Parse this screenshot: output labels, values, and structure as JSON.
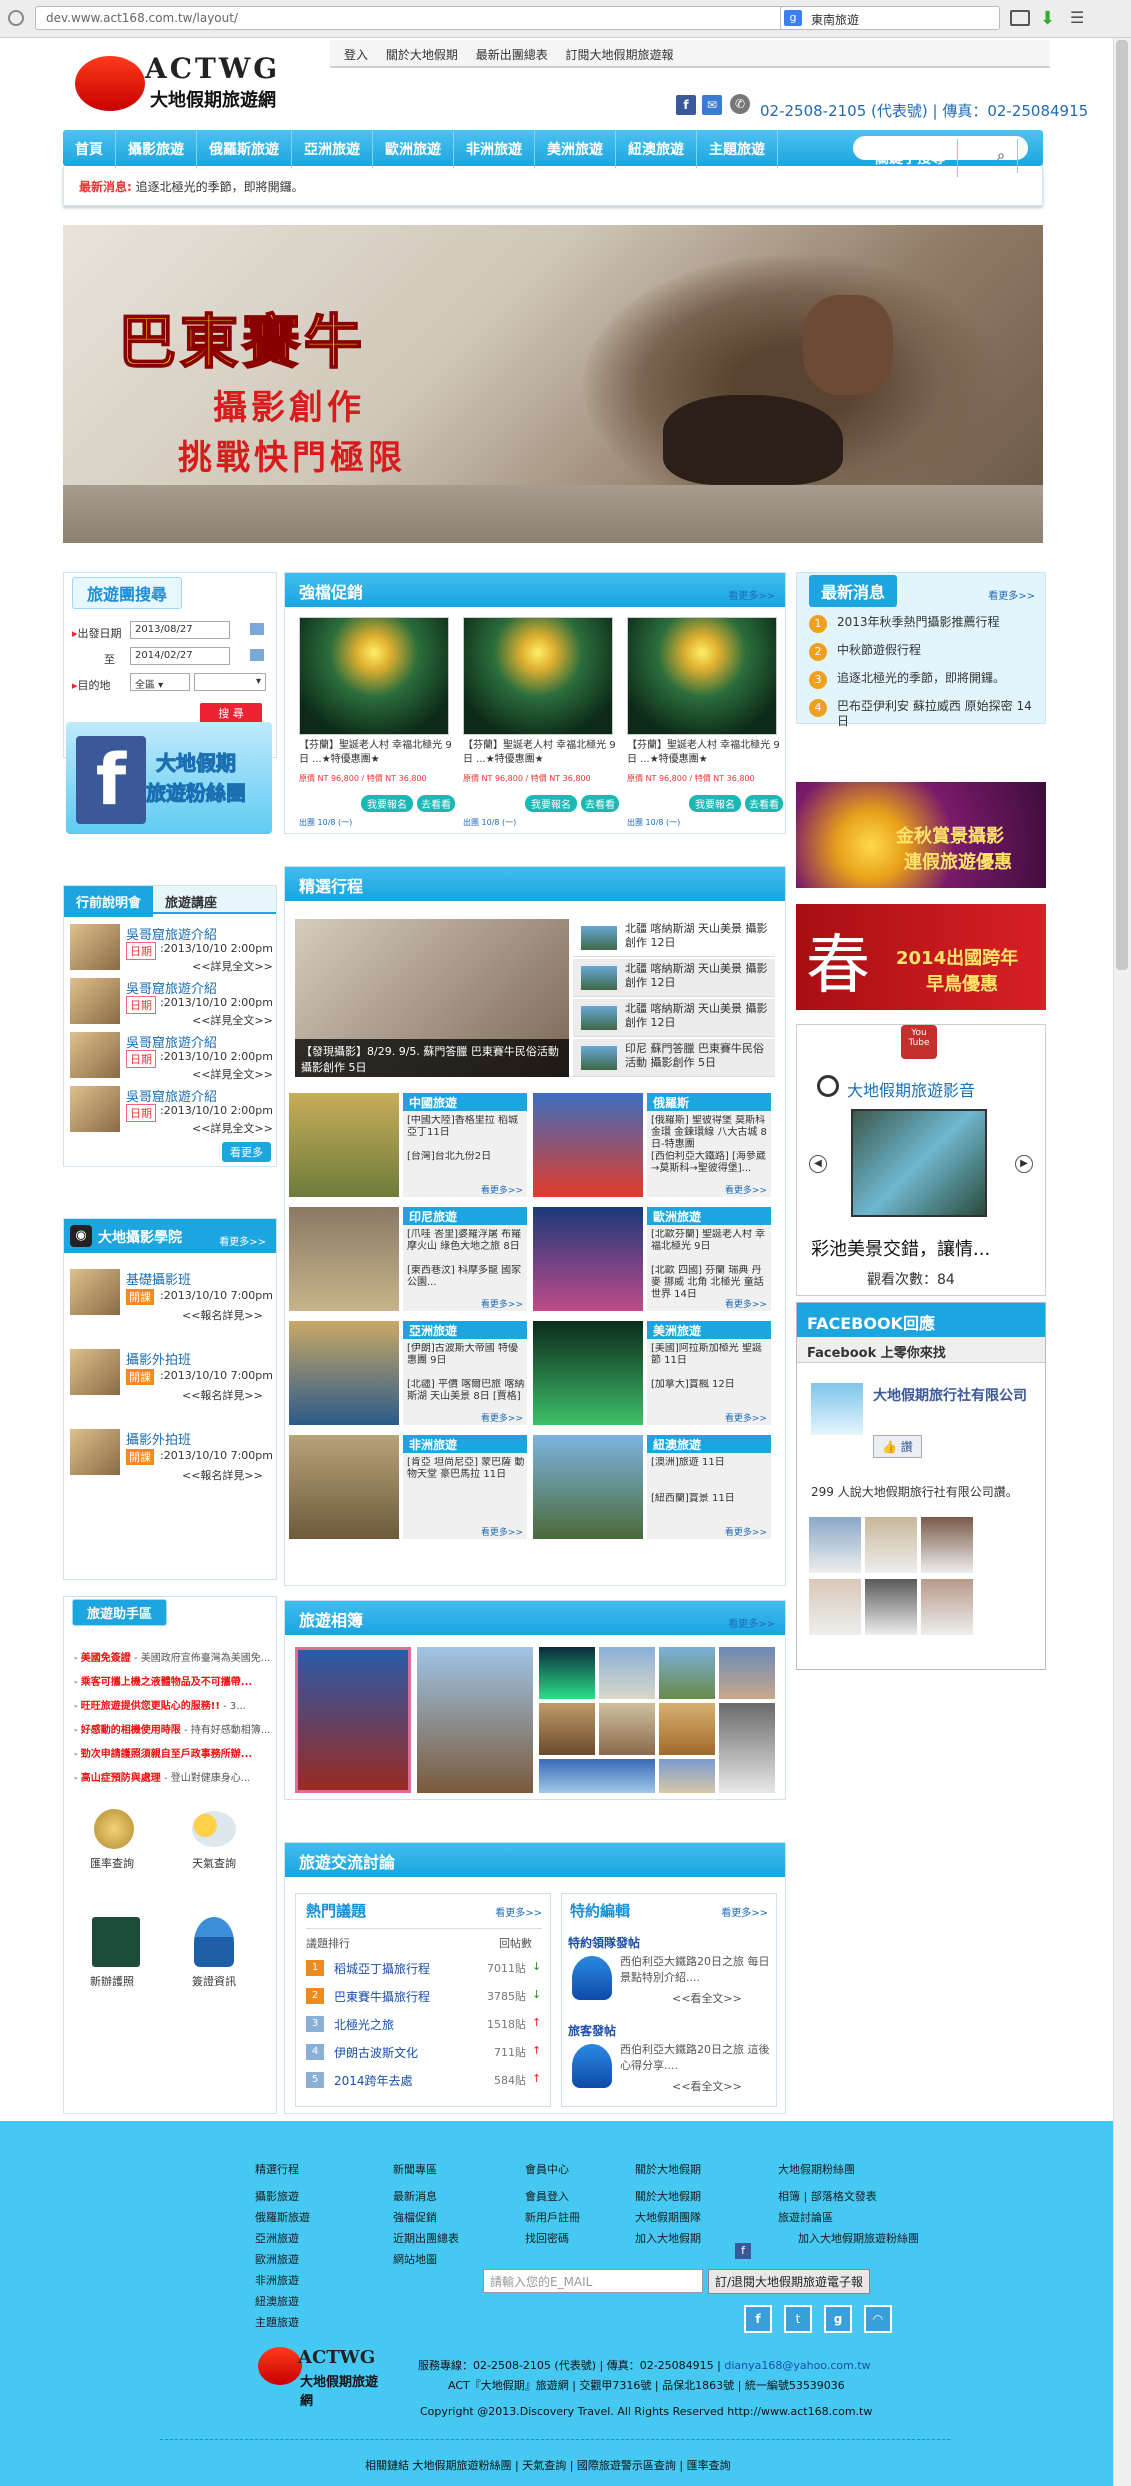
{
  "browser": {
    "url": "dev.www.act168.com.tw/layout/",
    "search_engine": "g",
    "search_value": "東南旅遊"
  },
  "header": {
    "links": [
      "登入",
      "關於大地假期",
      "最新出團總表",
      "訂閱大地假期旅遊報"
    ],
    "logo_en": "ACTWG",
    "logo_zh": "大地假期旅遊網",
    "contact": "02-2508-2105 (代表號) | 傳真：02-25084915"
  },
  "nav": {
    "items": [
      "首頁",
      "攝影旅遊",
      "俄羅斯旅遊",
      "亞洲旅遊",
      "歐洲旅遊",
      "非洲旅遊",
      "美洲旅遊",
      "紐澳旅遊",
      "主題旅遊"
    ],
    "search_placeholder": "關鍵字搜尋"
  },
  "news_bar": {
    "label": "最新消息:",
    "text": "追逐北極光的季節，即將開鑼。"
  },
  "banner": {
    "title": "巴東賽牛",
    "line1": "攝影創作",
    "line2": "挑戰快門極限"
  },
  "search_panel": {
    "title": "旅遊團搜尋",
    "depart_label": "出發日期",
    "depart_value": "2013/08/27",
    "to_label": "至",
    "to_value": "2014/02/27",
    "dest_label": "目的地",
    "dest_value": "全區",
    "submit": "搜 尋"
  },
  "fb_fans": {
    "line1": "大地假期",
    "line2": "旅遊粉絲團"
  },
  "briefing": {
    "tabs": [
      "行前說明會",
      "旅遊講座"
    ],
    "items": [
      {
        "title": "吳哥窟旅遊介紹",
        "tag": "日期",
        "date": ":2013/10/10 2:00pm",
        "more": "<<詳見全文>>"
      },
      {
        "title": "吳哥窟旅遊介紹",
        "tag": "日期",
        "date": ":2013/10/10 2:00pm",
        "more": "<<詳見全文>>"
      },
      {
        "title": "吳哥窟旅遊介紹",
        "tag": "日期",
        "date": ":2013/10/10 2:00pm",
        "more": "<<詳見全文>>"
      },
      {
        "title": "吳哥窟旅遊介紹",
        "tag": "日期",
        "date": ":2013/10/10 2:00pm",
        "more": "<<詳見全文>>"
      }
    ],
    "more": "看更多"
  },
  "academy": {
    "title": "大地攝影學院",
    "more": "看更多>>",
    "items": [
      {
        "title": "基礎攝影班",
        "tag": "開課",
        "date": ":2013/10/10 7:00pm",
        "more": "<<報名詳見>>"
      },
      {
        "title": "攝影外拍班",
        "tag": "開課",
        "date": ":2013/10/10 7:00pm",
        "more": "<<報名詳見>>"
      },
      {
        "title": "攝影外拍班",
        "tag": "開課",
        "date": ":2013/10/10 7:00pm",
        "more": "<<報名詳見>>"
      }
    ]
  },
  "travel_help": {
    "title": "旅遊助手區",
    "items": [
      {
        "head": "美國免簽證",
        "rest": " - 美國政府宣佈臺灣為美國免..."
      },
      {
        "head": "乘客可攜上機之液體物品及不可攜帶...",
        "rest": ""
      },
      {
        "head": "旺旺旅遊提供您更貼心的服務!!",
        "rest": " - 3..."
      },
      {
        "head": "好感動的相機使用時限",
        "rest": " - 持有好感動相簿..."
      },
      {
        "head": "勁次申請護照須親自至戶政事務所辦...",
        "rest": ""
      },
      {
        "head": "高山症預防與處理",
        "rest": " - 登山對健康身心..."
      }
    ],
    "tools": [
      "匯率查詢",
      "天氣查詢",
      "新辦護照",
      "簽證資訊"
    ]
  },
  "promo": {
    "title": "強檔促銷",
    "more": "看更多>>",
    "cards": [
      {
        "name": "【芬蘭】聖誕老人村 幸福北極光 9日 ...★特優惠團★",
        "price_line": "原價 NT 96,800 / 特價 NT 36,800",
        "book": "我要報名",
        "view": "去看看",
        "note": "出團 10/8 (一)"
      },
      {
        "name": "【芬蘭】聖誕老人村 幸福北極光 9日 ...★特優惠團★",
        "price_line": "原價 NT 96,800 / 特價 NT 36,800",
        "book": "我要報名",
        "view": "去看看",
        "note": "出團 10/8 (一)"
      },
      {
        "name": "【芬蘭】聖誕老人村 幸福北極光 9日 ...★特優惠團★",
        "price_line": "原價 NT 96,800 / 特價 NT 36,800",
        "book": "我要報名",
        "view": "去看看",
        "note": "出團 10/8 (一)"
      }
    ]
  },
  "featured": {
    "title": "精選行程",
    "main_caption": "【發現攝影】8/29. 9/5. 蘇門答臘 巴東賽牛民俗活動 攝影創作 5日",
    "side": [
      "北疆 喀納斯湖 天山美景 攝影創作 12日",
      "北疆 喀納斯湖 天山美景 攝影創作 12日",
      "北疆 喀納斯湖 天山美景 攝影創作 12日",
      "印尼 蘇門答臘 巴東賽牛民俗活動 攝影創作 5日"
    ],
    "regions": [
      {
        "name": "中國旅遊",
        "items": [
          "[中國大陸]香格里拉 稻城亞丁11日",
          "[台灣]台北九份2日"
        ],
        "more": "看更多>>"
      },
      {
        "name": "俄羅斯",
        "items": [
          "[俄羅斯] 聖彼得堡 莫斯科 金環 金鍊環線 八大古城 8日-特惠團",
          "[西伯利亞大鐵路] [海參崴→莫斯科→聖彼得堡]..."
        ],
        "more": "看更多>>"
      },
      {
        "name": "印尼旅遊",
        "items": [
          "[爪哇 峇里]婆羅浮屠 布羅摩火山 綠色大地之旅 8日",
          "[東西巷汶] 科摩多龍 國家公園..."
        ],
        "more": "看更多>>"
      },
      {
        "name": "歐洲旅遊",
        "items": [
          "[北歐芬蘭] 聖誕老人村 幸福北極光 9日",
          "[北歐 四國] 芬蘭 瑞典 丹麥 挪威 北角 北極光 童話世界 14日"
        ],
        "more": "看更多>>"
      },
      {
        "name": "亞洲旅遊",
        "items": [
          "[伊朗]古波斯大帝國 特優惠團 9日",
          "[北疆] 平價 喀爾巴旅 喀納斯湖 天山美景 8日 [賈格]"
        ],
        "more": "看更多>>"
      },
      {
        "name": "美洲旅遊",
        "items": [
          "[美國]阿拉斯加極光 聖誕節 11日",
          "[加拿大]賞楓 12日"
        ],
        "more": "看更多>>"
      },
      {
        "name": "非洲旅遊",
        "items": [
          "[肯亞 坦尚尼亞] 蒙巴薩 動物天堂 豪巴馬拉 11日"
        ],
        "more": "看更多>>"
      },
      {
        "name": "紐澳旅遊",
        "items": [
          "[澳洲]旅遊 11日",
          "[紐西蘭]賞景 11日"
        ],
        "more": "看更多>>"
      }
    ]
  },
  "album": {
    "title": "旅遊相簿",
    "more": "看更多>>"
  },
  "forum": {
    "title": "旅遊交流討論",
    "hot": {
      "title": "熱門議題",
      "more": "看更多>>",
      "col1": "議題排行",
      "col2": "回帖數",
      "rows": [
        {
          "rank": "1",
          "name": "稻城亞丁攝旅行程",
          "count": "7011貼"
        },
        {
          "rank": "2",
          "name": "巴東賽牛攝旅行程",
          "count": "3785貼"
        },
        {
          "rank": "3",
          "name": "北極光之旅",
          "count": "1518貼"
        },
        {
          "rank": "4",
          "name": "伊朗古波斯文化",
          "count": "711貼"
        },
        {
          "rank": "5",
          "name": "2014跨年去處",
          "count": "584貼"
        }
      ]
    },
    "editor": {
      "title": "特約編輯",
      "more": "看更多>>",
      "posts": [
        {
          "title": "特約領隊發帖",
          "text": "西伯利亞大鐵路20日之旅 每日景點特別介紹....",
          "more": "<<看全文>>"
        },
        {
          "title": "旅客發帖",
          "text": "西伯利亞大鐵路20日之旅 這後心得分享....",
          "more": "<<看全文>>"
        }
      ]
    }
  },
  "latest": {
    "title": "最新消息",
    "more": "看更多>>",
    "items": [
      "2013年秋季熱門攝影推薦行程",
      "中秋節遊假行程",
      "追逐北極光的季節，即將開鑼。",
      "巴布亞伊利安 蘇拉威西 原始探密 14日"
    ]
  },
  "side_promos": [
    {
      "line1": "金秋賞景攝影",
      "line2": "連假旅遊優惠"
    },
    {
      "line1": "2014出國跨年",
      "line2": "早鳥優惠"
    }
  ],
  "video": {
    "badge": "You Tube",
    "title": "大地假期旅遊影音",
    "caption": "彩池美景交錯，讓情...",
    "views": "觀看次數：84"
  },
  "facebook": {
    "title": "FACEBOOK回應",
    "sub": "Facebook 上零你來找",
    "page": "大地假期旅行社有限公司",
    "like": "讚",
    "count_text": "299 人說大地假期旅行社有限公司讚。"
  },
  "footer": {
    "cols": [
      {
        "head": "精選行程",
        "items": [
          "攝影旅遊",
          "俄羅斯旅遊",
          "亞洲旅遊",
          "歐洲旅遊",
          "非洲旅遊",
          "紐澳旅遊",
          "主題旅遊"
        ]
      },
      {
        "head": "新聞專區",
        "items": [
          "最新消息",
          "強檔促銷",
          "近期出團總表",
          "網站地圖"
        ]
      },
      {
        "head": "會員中心",
        "items": [
          "會員登入",
          "新用戶註冊",
          "找回密碼"
        ]
      },
      {
        "head": "關於大地假期",
        "items": [
          "關於大地假期",
          "大地假期團隊",
          "加入大地假期"
        ]
      },
      {
        "head": "大地假期粉絲團",
        "items": [
          "相簿 | 部落格文發表",
          "旅遊討論區",
          "加入大地假期旅遊粉絲團"
        ]
      }
    ],
    "email_placeholder": "請輸入您的E_MAIL",
    "subscribe": "訂/退閱大地假期旅遊電子報",
    "contact": "服務專線：02-2508-2105 (代表號) | 傳真：02-25084915 |",
    "email": "dianya168@yahoo.com.tw",
    "license": "ACT『大地假期』旅遊網 | 交觀甲7316號 | 品保北1863號 | 統一編號53539036",
    "copyright": "Copyright @2013.Discovery Travel. All Rights Reserved http://www.act168.com.tw",
    "bottom_links": "相關鏈結 大地假期旅遊粉絲團 | 天氣查詢 | 國際旅遊警示區查詢 | 匯率查詢"
  }
}
